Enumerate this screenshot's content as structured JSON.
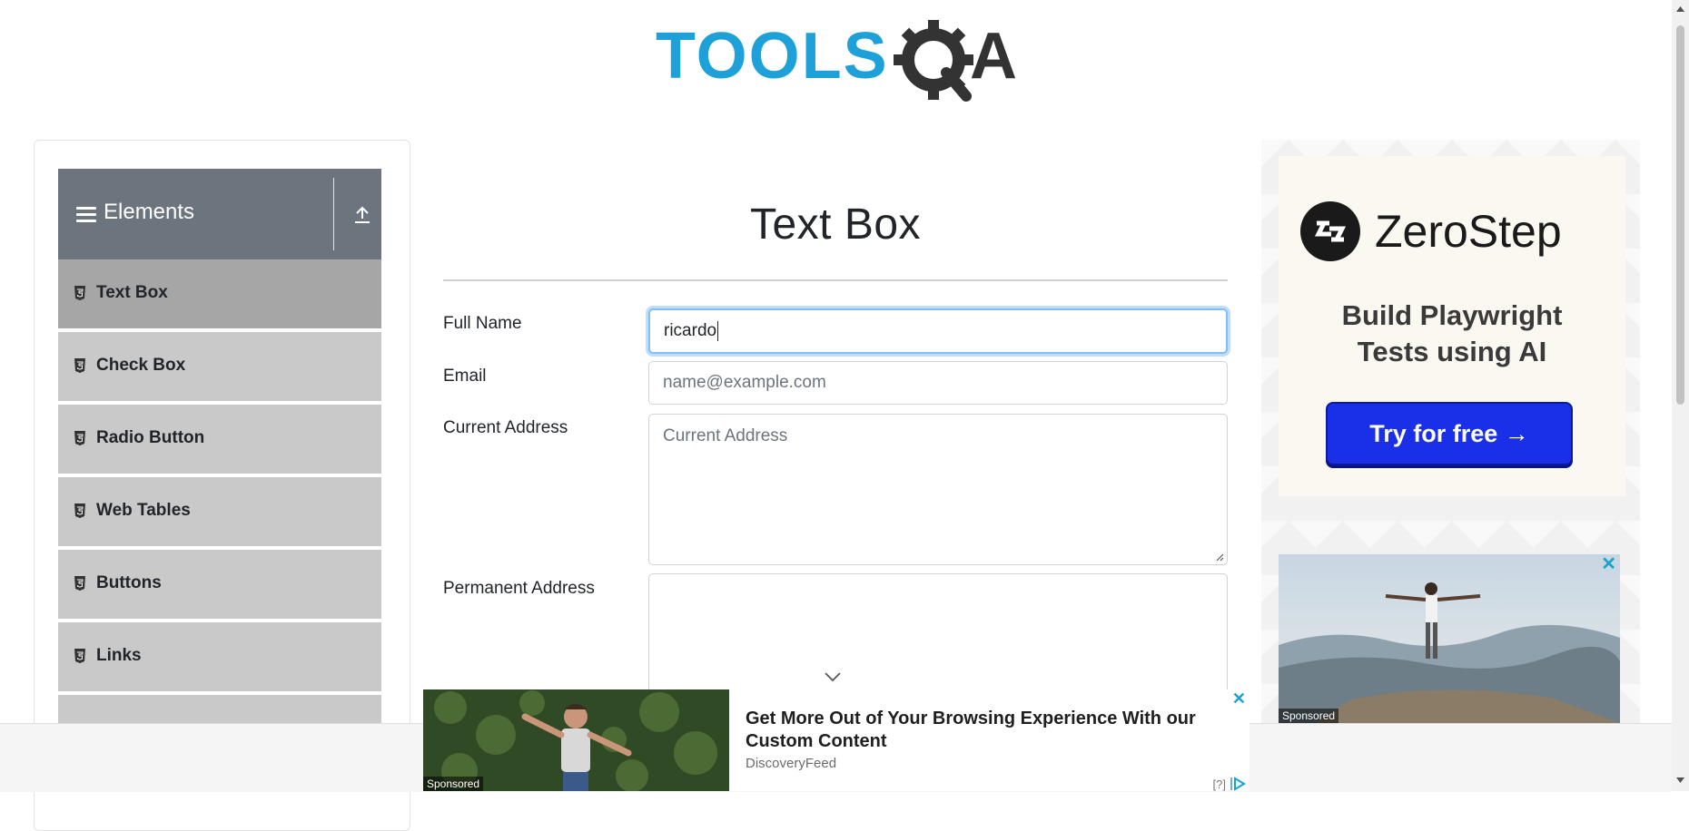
{
  "header": {
    "logo_text": "TOOLSQA"
  },
  "sidebar": {
    "group_title": "Elements",
    "items": [
      {
        "label": "Text Box",
        "active": true
      },
      {
        "label": "Check Box"
      },
      {
        "label": "Radio Button"
      },
      {
        "label": "Web Tables"
      },
      {
        "label": "Buttons"
      },
      {
        "label": "Links"
      }
    ]
  },
  "main": {
    "title": "Text Box",
    "fields": {
      "full_name": {
        "label": "Full Name",
        "value": "ricardo"
      },
      "email": {
        "label": "Email",
        "placeholder": "name@example.com"
      },
      "current_address": {
        "label": "Current Address",
        "placeholder": "Current Address"
      },
      "permanent_address": {
        "label": "Permanent Address",
        "value": ""
      }
    }
  },
  "right_ad": {
    "brand": "ZeroStep",
    "tagline_line1": "Build Playwright",
    "tagline_line2": "Tests using AI",
    "cta": "Try for free →",
    "sponsored": "Sponsored"
  },
  "bottom_ad": {
    "headline": "Get More Out of Your Browsing Experience With our Custom Content",
    "source": "DiscoveryFeed",
    "sponsored": "Sponsored",
    "info": "[?]"
  },
  "colors": {
    "accent_blue": "#1da1d8",
    "sidebar_header": "#6c757d",
    "active_item": "#a6a6a6",
    "item_bg": "#c9c9c9",
    "cta_blue": "#1a2fe8"
  }
}
